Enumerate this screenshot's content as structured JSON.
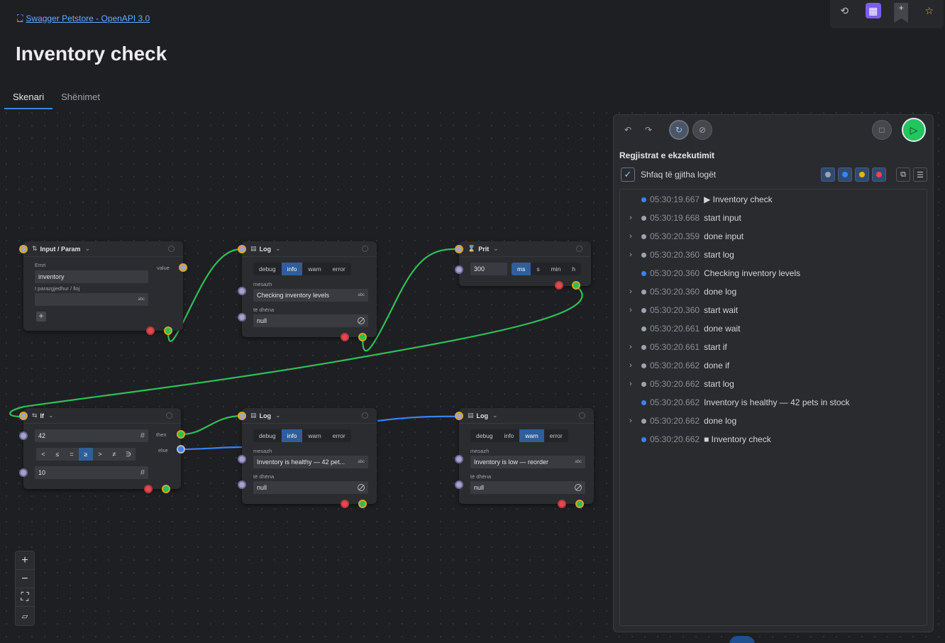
{
  "header": {
    "link": "Swagger Petstore - OpenAPI 3.0",
    "title": "Inventory check",
    "tabs": [
      "Skenari",
      "Shënimet"
    ]
  },
  "nodes": {
    "input": {
      "title": "Input / Param",
      "name_label": "Emri",
      "name_value": "inventory",
      "default_label": "I parazgjedhur / lloj",
      "suffix": "abc",
      "out_label": "value"
    },
    "log1": {
      "title": "Log",
      "levels": [
        "debug",
        "info",
        "warn",
        "error"
      ],
      "active": "info",
      "msg_label": "mesazh",
      "msg_value": "Checking inventory levels",
      "data_label": "të dhëna",
      "data_value": "null",
      "suffix": "abc"
    },
    "wait": {
      "title": "Prit",
      "value": "300",
      "units": [
        "ms",
        "s",
        "min",
        "h"
      ],
      "active": "ms"
    },
    "if": {
      "title": "If",
      "left": "42",
      "right": "10",
      "ops": [
        "<",
        "≤",
        "=",
        "≥",
        ">",
        "≠",
        "∋"
      ],
      "active_op": "≥",
      "then": "then",
      "else": "else",
      "hash": "#"
    },
    "log2": {
      "title": "Log",
      "levels": [
        "debug",
        "info",
        "warn",
        "error"
      ],
      "active": "info",
      "msg_label": "mesazh",
      "msg_value": "Inventory is healthy — 42 pet...",
      "data_label": "të dhëna",
      "data_value": "null",
      "suffix": "abc"
    },
    "log3": {
      "title": "Log",
      "levels": [
        "debug",
        "info",
        "warn",
        "error"
      ],
      "active": "warn",
      "msg_label": "mesazh",
      "msg_value": "Inventory is low — reorder",
      "data_label": "të dhëna",
      "data_value": "null",
      "suffix": "abc"
    }
  },
  "panel": {
    "title": "Regjistrat e ekzekutimit",
    "show_all": "Shfaq të gjitha logët",
    "filter_colors": [
      "#9ca3af",
      "#3b82f6",
      "#eab308",
      "#ef4444"
    ],
    "logs": [
      {
        "time": "05:30:19.667",
        "text": "▶ Inventory check",
        "dot": "#3b82f6",
        "expand": false
      },
      {
        "time": "05:30:19.668",
        "text": "start input",
        "dot": "#9ca3af",
        "expand": true
      },
      {
        "time": "05:30:20.359",
        "text": "done input",
        "dot": "#9ca3af",
        "expand": true
      },
      {
        "time": "05:30:20.360",
        "text": "start log",
        "dot": "#9ca3af",
        "expand": true
      },
      {
        "time": "05:30:20.360",
        "text": "Checking inventory levels",
        "dot": "#3b82f6",
        "expand": false
      },
      {
        "time": "05:30:20.360",
        "text": "done log",
        "dot": "#9ca3af",
        "expand": true
      },
      {
        "time": "05:30:20.360",
        "text": "start wait",
        "dot": "#9ca3af",
        "expand": true
      },
      {
        "time": "05:30:20.661",
        "text": "done wait",
        "dot": "#9ca3af",
        "expand": false
      },
      {
        "time": "05:30:20.661",
        "text": "start if",
        "dot": "#9ca3af",
        "expand": true
      },
      {
        "time": "05:30:20.662",
        "text": "done if",
        "dot": "#9ca3af",
        "expand": true
      },
      {
        "time": "05:30:20.662",
        "text": "start log",
        "dot": "#9ca3af",
        "expand": true
      },
      {
        "time": "05:30:20.662",
        "text": "Inventory is healthy — 42 pets in stock",
        "dot": "#3b82f6",
        "expand": false
      },
      {
        "time": "05:30:20.662",
        "text": "done log",
        "dot": "#9ca3af",
        "expand": true
      },
      {
        "time": "05:30:20.662",
        "text": "■ Inventory check",
        "dot": "#3b82f6",
        "expand": false
      }
    ]
  },
  "icons": [
    "history-icon",
    "calculator-icon",
    "bookmark-icon",
    "star-icon",
    "undo-icon",
    "redo-icon",
    "stop-icon",
    "play-icon",
    "copy-icon",
    "clear-icon",
    "zoom-in-icon",
    "zoom-out-icon",
    "fit-icon",
    "map-icon"
  ]
}
